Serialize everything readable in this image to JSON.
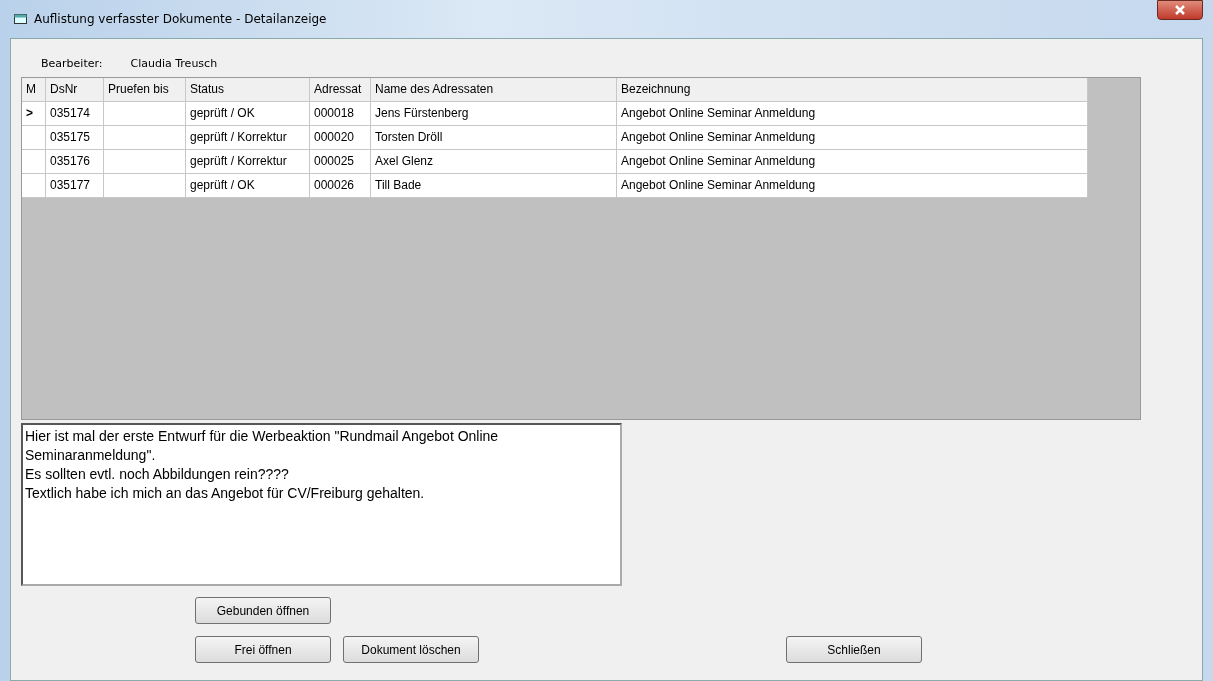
{
  "window": {
    "title": "Auflistung verfasster Dokumente - Detailanzeige"
  },
  "editor": {
    "label": "Bearbeiter:",
    "value": "Claudia Treusch"
  },
  "table": {
    "columns": [
      "M",
      "DsNr",
      "Pruefen bis",
      "Status",
      "Adressat",
      "Name des Adressaten",
      "Bezeichnung"
    ],
    "rows": [
      {
        "marker": ">",
        "dsnr": "035174",
        "status": "geprüft / OK",
        "adressat": "000018",
        "name": "Jens Fürstenberg",
        "bezeichnung": "Angebot Online Seminar Anmeldung"
      },
      {
        "dsnr": "035175",
        "status": "geprüft / Korrektur",
        "adressat": "000020",
        "name": "Torsten Dröll",
        "bezeichnung": "Angebot Online Seminar Anmeldung"
      },
      {
        "dsnr": "035176",
        "status": "geprüft / Korrektur",
        "adressat": "000025",
        "name": "Axel Glenz",
        "bezeichnung": "Angebot Online Seminar Anmeldung"
      },
      {
        "dsnr": "035177",
        "status": "geprüft / OK",
        "adressat": "000026",
        "name": "Till Bade",
        "bezeichnung": "Angebot Online Seminar Anmeldung"
      }
    ]
  },
  "memo": {
    "lines": [
      "Hier ist mal der erste Entwurf für die Werbeaktion \"Rundmail Angebot Online Seminaranmeldung\".",
      "Es sollten evtl. noch Abbildungen rein????",
      "Textlich habe ich mich an das Angebot für CV/Freiburg gehalten."
    ]
  },
  "buttons": {
    "bound_open": "Gebunden öffnen",
    "free_open": "Frei öffnen",
    "delete": "Dokument löschen",
    "close": "Schließen"
  }
}
